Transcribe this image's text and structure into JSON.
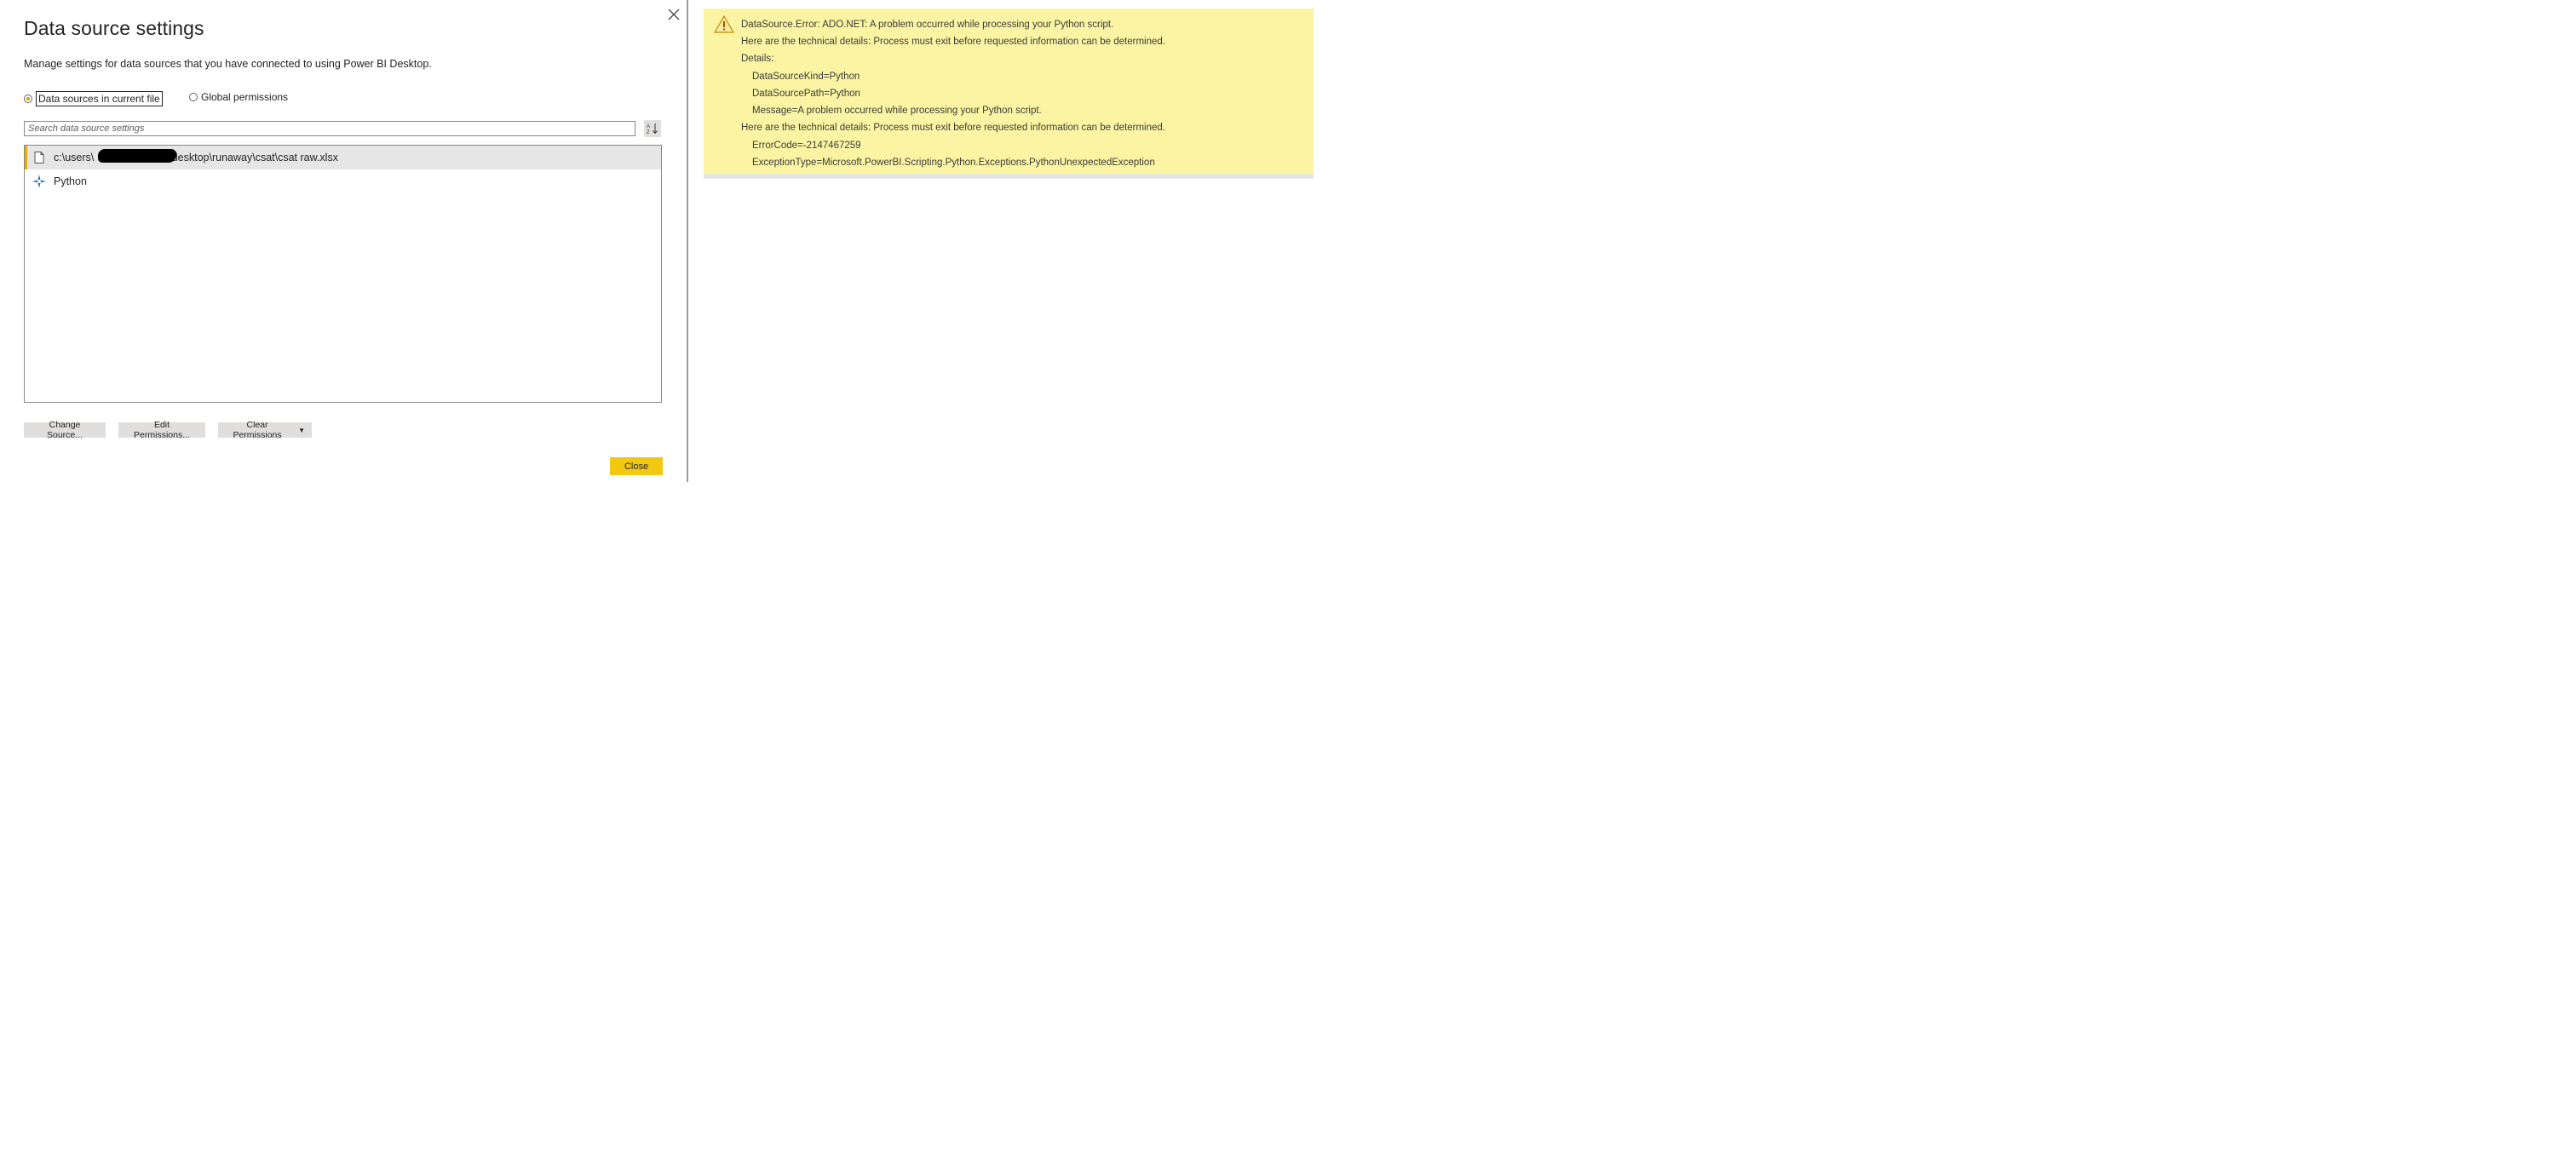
{
  "dialog": {
    "title": "Data source settings",
    "subtitle": "Manage settings for data sources that you have connected to using Power BI Desktop.",
    "scope": {
      "current_file_label": "Data sources in current file",
      "global_label": "Global permissions",
      "selected": "current_file"
    },
    "search": {
      "placeholder": "Search data source settings"
    },
    "sources": [
      {
        "label_prefix": "c:\\users\\",
        "label_suffix": "\\desktop\\runaway\\csat\\csat raw.xlsx",
        "icon": "file-icon",
        "selected": true
      },
      {
        "label": "Python",
        "icon": "python-connector-icon",
        "selected": false
      }
    ],
    "buttons": {
      "change_source": "Change Source...",
      "edit_permissions": "Edit Permissions...",
      "clear_permissions": "Clear Permissions",
      "close": "Close"
    }
  },
  "error": {
    "lines": [
      "DataSource.Error: ADO.NET: A problem occurred while processing your Python script.",
      "Here are the technical details: Process must exit before requested information can be determined.",
      "Details:",
      "DataSourceKind=Python",
      "DataSourcePath=Python",
      "Message=A problem occurred while processing your Python script.",
      "Here are the technical details: Process must exit before requested information can be determined.",
      "ErrorCode=-2147467259",
      "ExceptionType=Microsoft.PowerBI.Scripting.Python.Exceptions.PythonUnexpectedException"
    ]
  },
  "colors": {
    "accent": "#f2c811",
    "error_background": "#fbf5a3",
    "selected_row": "#e6e6e6",
    "button_gray": "#e1dfdd"
  }
}
